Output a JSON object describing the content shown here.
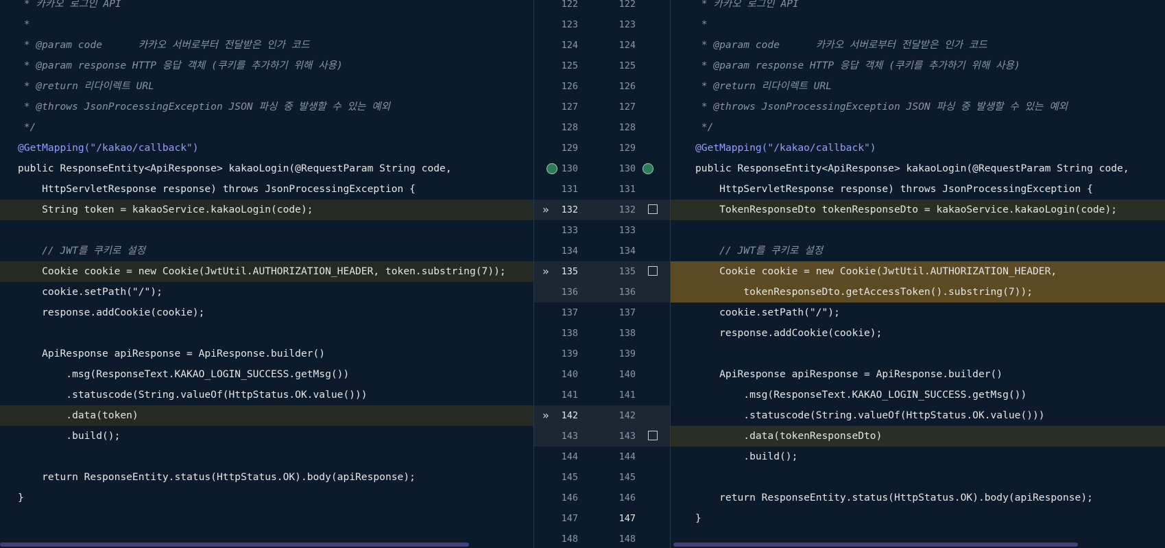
{
  "left_lines": [
    {
      "text": " * 카카오 로그인 API",
      "cls": "cmt"
    },
    {
      "text": " *",
      "cls": "cmt"
    },
    {
      "text": " * @param code      카카오 서버로부터 전달받은 인가 코드",
      "cls": "cmt"
    },
    {
      "text": " * @param response HTTP 응답 객체 (쿠키를 추가하기 위해 사용)",
      "cls": "cmt"
    },
    {
      "text": " * @return 리다이렉트 URL",
      "cls": "cmt"
    },
    {
      "text": " * @throws JsonProcessingException JSON 파싱 중 발생할 수 있는 예외",
      "cls": "cmt"
    },
    {
      "text": " */",
      "cls": "cmt"
    },
    {
      "text": "@GetMapping(\"/kakao/callback\")",
      "cls": "ann"
    },
    {
      "text": "public ResponseEntity<ApiResponse> kakaoLogin(@RequestParam String code,",
      "cls": "plain"
    },
    {
      "text": "    HttpServletResponse response) throws JsonProcessingException {",
      "cls": "plain"
    },
    {
      "text": "    String token = kakaoService.kakaoLogin(code);",
      "cls": "plain"
    },
    {
      "text": "",
      "cls": "plain"
    },
    {
      "text": "    // JWT를 쿠키로 설정",
      "cls": "cmt"
    },
    {
      "text": "    Cookie cookie = new Cookie(JwtUtil.AUTHORIZATION_HEADER, token.substring(7));",
      "cls": "plain"
    },
    {
      "text": "    cookie.setPath(\"/\");",
      "cls": "plain"
    },
    {
      "text": "    response.addCookie(cookie);",
      "cls": "plain"
    },
    {
      "text": "",
      "cls": "plain"
    },
    {
      "text": "    ApiResponse apiResponse = ApiResponse.builder()",
      "cls": "plain"
    },
    {
      "text": "        .msg(ResponseText.KAKAO_LOGIN_SUCCESS.getMsg())",
      "cls": "plain"
    },
    {
      "text": "        .statuscode(String.valueOf(HttpStatus.OK.value()))",
      "cls": "plain"
    },
    {
      "text": "        .data(token)",
      "cls": "plain"
    },
    {
      "text": "        .build();",
      "cls": "plain"
    },
    {
      "text": "",
      "cls": "plain"
    },
    {
      "text": "    return ResponseEntity.status(HttpStatus.OK).body(apiResponse);",
      "cls": "plain"
    },
    {
      "text": "}",
      "cls": "plain"
    }
  ],
  "right_lines": [
    {
      "text": " * 카카오 로그인 API",
      "cls": "cmt"
    },
    {
      "text": " *",
      "cls": "cmt"
    },
    {
      "text": " * @param code      카카오 서버로부터 전달받은 인가 코드",
      "cls": "cmt"
    },
    {
      "text": " * @param response HTTP 응답 객체 (쿠키를 추가하기 위해 사용)",
      "cls": "cmt"
    },
    {
      "text": " * @return 리다이렉트 URL",
      "cls": "cmt"
    },
    {
      "text": " * @throws JsonProcessingException JSON 파싱 중 발생할 수 있는 예외",
      "cls": "cmt"
    },
    {
      "text": " */",
      "cls": "cmt"
    },
    {
      "text": "@GetMapping(\"/kakao/callback\")",
      "cls": "ann"
    },
    {
      "text": "public ResponseEntity<ApiResponse> kakaoLogin(@RequestParam String code,",
      "cls": "plain"
    },
    {
      "text": "    HttpServletResponse response) throws JsonProcessingException {",
      "cls": "plain"
    },
    {
      "text": "    TokenResponseDto tokenResponseDto = kakaoService.kakaoLogin(code);",
      "cls": "plain"
    },
    {
      "text": "",
      "cls": "plain"
    },
    {
      "text": "    // JWT를 쿠키로 설정",
      "cls": "cmt"
    },
    {
      "text": "    Cookie cookie = new Cookie(JwtUtil.AUTHORIZATION_HEADER,",
      "cls": "plain"
    },
    {
      "text": "        tokenResponseDto.getAccessToken().substring(7));",
      "cls": "plain"
    },
    {
      "text": "    cookie.setPath(\"/\");",
      "cls": "plain"
    },
    {
      "text": "    response.addCookie(cookie);",
      "cls": "plain"
    },
    {
      "text": "",
      "cls": "plain"
    },
    {
      "text": "    ApiResponse apiResponse = ApiResponse.builder()",
      "cls": "plain"
    },
    {
      "text": "        .msg(ResponseText.KAKAO_LOGIN_SUCCESS.getMsg())",
      "cls": "plain"
    },
    {
      "text": "        .statuscode(String.valueOf(HttpStatus.OK.value()))",
      "cls": "plain"
    },
    {
      "text": "        .data(tokenResponseDto)",
      "cls": "plain"
    },
    {
      "text": "        .build();",
      "cls": "plain"
    },
    {
      "text": "",
      "cls": "plain"
    },
    {
      "text": "    return ResponseEntity.status(HttpStatus.OK).body(apiResponse);",
      "cls": "plain"
    },
    {
      "text": "}",
      "cls": "plain"
    }
  ],
  "gutter_left_numbers": [
    "122",
    "123",
    "124",
    "125",
    "126",
    "127",
    "128",
    "129",
    "130",
    "131",
    "132",
    "133",
    "134",
    "135",
    "136",
    "137",
    "138",
    "139",
    "140",
    "141",
    "142",
    "143",
    "144",
    "145",
    "146",
    "147",
    "148"
  ],
  "gutter_right_numbers": [
    "122",
    "123",
    "124",
    "125",
    "126",
    "127",
    "128",
    "129",
    "130",
    "131",
    "132",
    "133",
    "134",
    "135",
    "136",
    "137",
    "138",
    "139",
    "140",
    "141",
    "142",
    "143",
    "144",
    "145",
    "146",
    "147",
    "148"
  ],
  "left_changed_rows": [
    10,
    13,
    20
  ],
  "right_changed_rows": [
    10,
    13,
    14,
    21
  ],
  "chevron_rows": [
    10,
    13,
    20
  ],
  "checkbox_rows": [
    10,
    13,
    21
  ],
  "icons": {
    "chevron": "double-chevron-right-icon",
    "checkbox": "checkbox-icon",
    "bubble": "run-method-icon"
  },
  "colors": {
    "background": "#0b1b2b",
    "changed": "#262a22",
    "inserted": "#5b4a22",
    "scrollbar": "#453d7a"
  }
}
